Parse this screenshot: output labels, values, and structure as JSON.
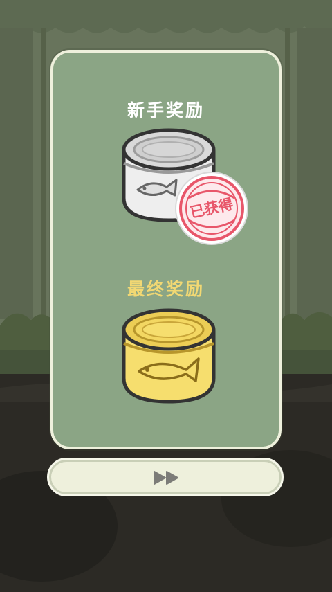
{
  "rewards": {
    "starter": {
      "title": "新手奖励",
      "item_icon": "silver-fish-can-icon",
      "stamp_text": "已获得"
    },
    "final": {
      "title": "最终奖励",
      "item_icon": "gold-fish-can-icon"
    }
  },
  "next_button": {
    "icon": "fast-forward-icon"
  },
  "colors": {
    "panel_bg": "#8ba585",
    "panel_border": "#eef0dc",
    "starter_title": "#ffffff",
    "final_title": "#f2d873",
    "stamp": "#e8566a",
    "gold_can": "#f6de6e"
  }
}
